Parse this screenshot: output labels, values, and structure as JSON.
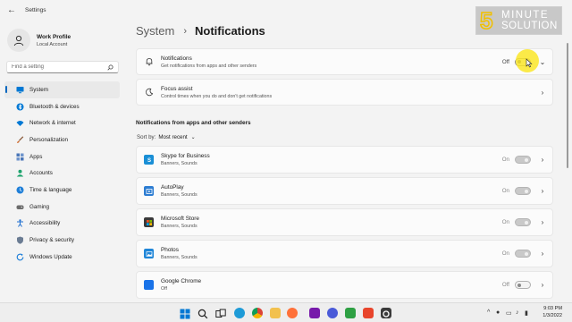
{
  "window": {
    "app_title": "Settings"
  },
  "profile": {
    "name": "Work Profile",
    "account": "Local Account"
  },
  "search": {
    "placeholder": "Find a setting"
  },
  "sidebar": {
    "items": [
      {
        "label": "System",
        "icon": "system-icon",
        "color": "#0078d4",
        "active": true
      },
      {
        "label": "Bluetooth & devices",
        "icon": "bluetooth-icon",
        "color": "#0078d4"
      },
      {
        "label": "Network & internet",
        "icon": "wifi-icon",
        "color": "#0078d4"
      },
      {
        "label": "Personalization",
        "icon": "brush-icon",
        "color": "#d06a2c"
      },
      {
        "label": "Apps",
        "icon": "apps-icon",
        "color": "#4a76b8"
      },
      {
        "label": "Accounts",
        "icon": "accounts-icon",
        "color": "#1ea36d"
      },
      {
        "label": "Time & language",
        "icon": "globe-clock-icon",
        "color": "#1f7fd8"
      },
      {
        "label": "Gaming",
        "icon": "gaming-icon",
        "color": "#6b6b6b"
      },
      {
        "label": "Accessibility",
        "icon": "accessibility-icon",
        "color": "#1f6fd0"
      },
      {
        "label": "Privacy & security",
        "icon": "shield-icon",
        "color": "#6b7c93"
      },
      {
        "label": "Windows Update",
        "icon": "update-icon",
        "color": "#1f7fd8"
      }
    ]
  },
  "breadcrumb": {
    "parent": "System",
    "separator": "›",
    "title": "Notifications"
  },
  "notifications": {
    "title": "Notifications",
    "subtitle": "Get notifications from apps and other senders",
    "state": "Off",
    "expanded": false
  },
  "focus": {
    "title": "Focus assist",
    "subtitle": "Control times when you do and don't get notifications"
  },
  "section": {
    "header": "Notifications from apps and other senders"
  },
  "sort": {
    "label": "Sort by:",
    "value": "Most recent"
  },
  "apps": [
    {
      "name": "Skype for Business",
      "detail": "Banners, Sounds",
      "state": "On",
      "icon": "skype-icon",
      "color": "#1a8fd6"
    },
    {
      "name": "AutoPlay",
      "detail": "Banners, Sounds",
      "state": "On",
      "icon": "autoplay-icon",
      "color": "#2d7dd2"
    },
    {
      "name": "Microsoft Store",
      "detail": "Banners, Sounds",
      "state": "On",
      "icon": "store-icon",
      "color": "#3a3a3a"
    },
    {
      "name": "Photos",
      "detail": "Banners, Sounds",
      "state": "On",
      "icon": "photos-icon",
      "color": "#1f86d8"
    },
    {
      "name": "Google Chrome",
      "detail": "Off",
      "state": "Off",
      "icon": "chrome-icon",
      "color": "#1a73e8"
    }
  ],
  "logo": {
    "digit": "5",
    "line1": "MINUTE",
    "line2": "SOLUTION"
  },
  "taskbar": {
    "apps": [
      "windows-start-icon",
      "search-icon",
      "task-view-icon",
      "edge-icon",
      "chrome-taskbar-icon",
      "file-explorer-icon",
      "firefox-icon",
      "onenote-icon",
      "recorder-icon",
      "camtasia-icon",
      "snagit-icon",
      "settings-taskbar-icon"
    ],
    "tray_chevron": "^",
    "time": "9:03 PM",
    "date": "1/3/2022"
  }
}
